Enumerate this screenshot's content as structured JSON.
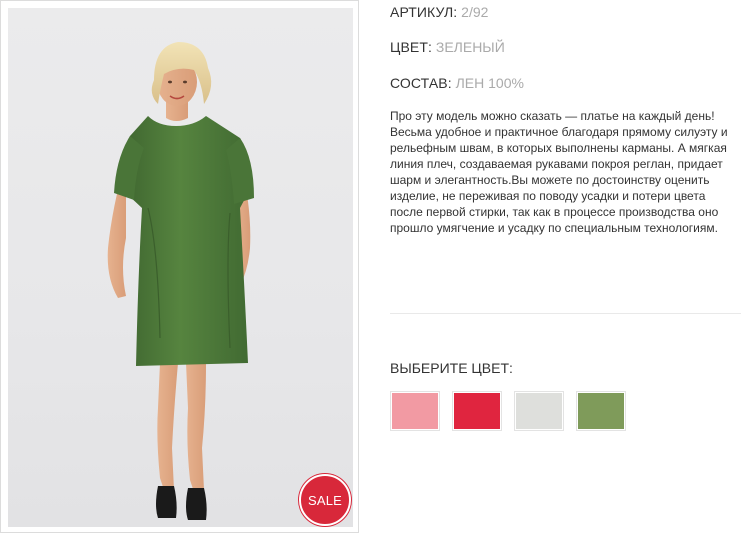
{
  "product": {
    "sale_badge": "SALE",
    "article_label": "АРТИКУЛ:",
    "article_value": "2/92",
    "color_label": "ЦВЕТ:",
    "color_value": "ЗЕЛЕНЫЙ",
    "composition_label": "СОСТАВ:",
    "composition_value": "ЛЕН 100%",
    "description": "Про эту модель можно сказать — платье на каждый день! Весьма удобное и практичное благодаря прямому силуэту и рельефным швам, в которых выполнены карманы. А мягкая линия плеч, создаваемая рукавами покроя реглан, придает шарм и элегантность.Вы можете по достоинству оценить изделие, не переживая по поводу усадки и потери цвета после первой стирки, так как в процессе производства оно прошло умягчение и усадку по специальным технологиям."
  },
  "color_picker": {
    "title": "ВЫБЕРИТЕ ЦВЕТ:",
    "swatches": [
      {
        "name": "pink",
        "color": "#f29aa3"
      },
      {
        "name": "red",
        "color": "#e0253f"
      },
      {
        "name": "light-gray",
        "color": "#dedfdc"
      },
      {
        "name": "green",
        "color": "#7f9b5a"
      }
    ]
  },
  "colors": {
    "sale": "#d8283a",
    "dress": "#4f7a3c",
    "muted_value": "#aaaaaa"
  }
}
